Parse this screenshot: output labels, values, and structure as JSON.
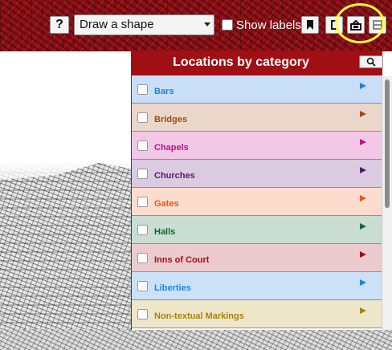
{
  "toolbar": {
    "help_label": "?",
    "shape_select_value": "Draw a shape",
    "show_labels_label": "Show labels",
    "show_labels_checked": false,
    "icons": [
      "bookmark-icon",
      "info-icon",
      "layers-icon",
      "grid-icon"
    ]
  },
  "panel": {
    "title": "Locations by category",
    "search_icon": "magnifier-icon",
    "categories": [
      {
        "label": "Bars",
        "bg": "#c9def7",
        "color": "#1a82d9",
        "arrow": "#1a82d9"
      },
      {
        "label": "Bridges",
        "bg": "#ebd6ca",
        "color": "#9c4d12",
        "arrow": "#9c4d12"
      },
      {
        "label": "Chapels",
        "bg": "#f3c8e7",
        "color": "#c0128e",
        "arrow": "#c0128e"
      },
      {
        "label": "Churches",
        "bg": "#dacbe1",
        "color": "#5d1670",
        "arrow": "#5d1670"
      },
      {
        "label": "Gates",
        "bg": "#fbdccd",
        "color": "#f05515",
        "arrow": "#f05515"
      },
      {
        "label": "Halls",
        "bg": "#c9ddd2",
        "color": "#0d6b33",
        "arrow": "#0d6b33"
      },
      {
        "label": "Inns of Court",
        "bg": "#ebcbcd",
        "color": "#a10f1b",
        "arrow": "#a10f1b"
      },
      {
        "label": "Liberties",
        "bg": "#cbe1f7",
        "color": "#1b86db",
        "arrow": "#1b86db"
      },
      {
        "label": "Non-textual Markings",
        "bg": "#eee6c9",
        "color": "#a6830b",
        "arrow": "#a6830b"
      }
    ]
  }
}
